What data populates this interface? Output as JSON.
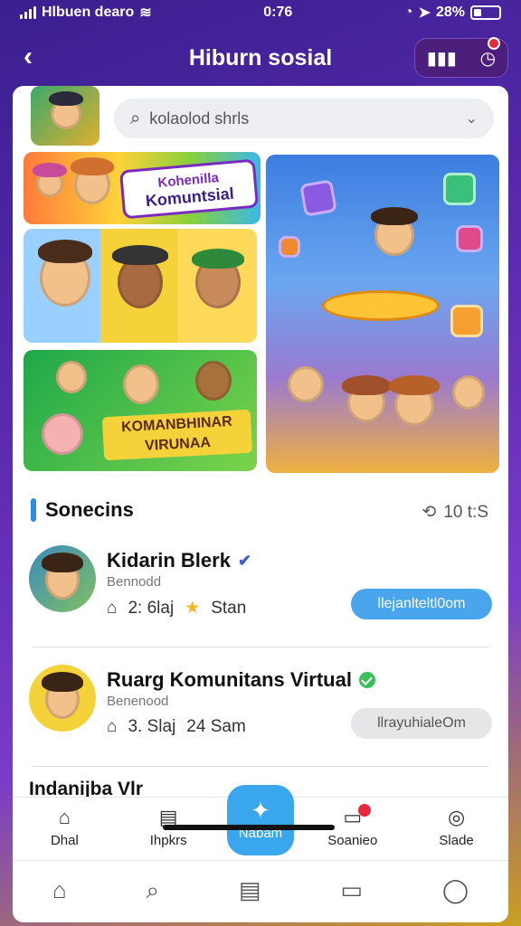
{
  "status_bar": {
    "carrier": "Hlbuen dearo",
    "time": "0:76",
    "battery": "28%"
  },
  "header": {
    "back_label": "‹",
    "title": "Hiburn sosial",
    "action_icons": [
      "grid-icon",
      "clock-icon"
    ]
  },
  "search": {
    "placeholder": "kolaolod shrls"
  },
  "banners": {
    "top_banner_line1": "Kohenilla",
    "top_banner_line2": "Komuntsial",
    "green_tile_label": "KOMANBHINAR VIRUNAA"
  },
  "section": {
    "title": "Sonecins",
    "meta": "10 t:S"
  },
  "communities": [
    {
      "name": "Kidarin Blerk",
      "subtitle": "Bennodd",
      "stat1": "2: 6laj",
      "stat2": "Stan",
      "join_label": "llejanlteltl0om",
      "join_style": "primary"
    },
    {
      "name": "Ruarg Komunitans Virtual",
      "subtitle": "Benenood",
      "stat1": "3. Slaj",
      "stat2": "24 Sam",
      "join_label": "llrayuhialeOm",
      "join_style": "secondary"
    }
  ],
  "peek_row_name": "Indanijba Vlr",
  "tabs": [
    {
      "label": "Dhal",
      "icon": "home-flag-icon"
    },
    {
      "label": "Ihpkrs",
      "icon": "list-icon"
    },
    {
      "label": "Nabam",
      "icon": "bird-icon"
    },
    {
      "label": "Soanieo",
      "icon": "chat-icon"
    },
    {
      "label": "Slade",
      "icon": "profile-search-icon"
    }
  ],
  "bottom_nav": [
    "home-icon",
    "search-icon",
    "document-icon",
    "tv-icon",
    "user-icon"
  ],
  "colors": {
    "accent": "#39a6ee",
    "brand_purple": "#4a1e7a"
  }
}
